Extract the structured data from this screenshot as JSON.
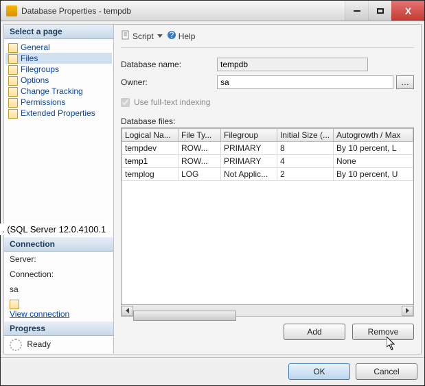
{
  "window": {
    "title": "Database Properties - tempdb"
  },
  "toolbar": {
    "script": "Script",
    "help": "Help"
  },
  "sidebar": {
    "select_page": "Select a page",
    "items": [
      {
        "label": "General"
      },
      {
        "label": "Files"
      },
      {
        "label": "Filegroups"
      },
      {
        "label": "Options"
      },
      {
        "label": "Change Tracking"
      },
      {
        "label": "Permissions"
      },
      {
        "label": "Extended Properties"
      }
    ],
    "connection_title": "Connection",
    "server_label": "Server:",
    "server_tooltip": ". (SQL Server 12.0.4100.1",
    "connection_label": "Connection:",
    "connection_value": "sa",
    "view_connection": "View connection ",
    "progress_title": "Progress",
    "progress_status": "Ready"
  },
  "form": {
    "db_name_label": "Database name:",
    "db_name_value": "tempdb",
    "owner_label": "Owner:",
    "owner_value": "sa",
    "fulltext_label": "Use full-text indexing",
    "fulltext_checked": true,
    "files_label": "Database files:"
  },
  "grid": {
    "headers": [
      "Logical Na...",
      "File Ty...",
      "Filegroup",
      "Initial Size (...",
      "Autogrowth / Max"
    ],
    "rows": [
      {
        "name": "tempdev",
        "type": "ROW...",
        "group": "PRIMARY",
        "size": "8",
        "auto": "By 10 percent, L"
      },
      {
        "name": "temp1",
        "type": "ROW...",
        "group": "PRIMARY",
        "size": "4",
        "auto": "None"
      },
      {
        "name": "templog",
        "type": "LOG",
        "group": "Not Applic...",
        "size": "2",
        "auto": "By 10 percent, U"
      }
    ]
  },
  "buttons": {
    "add": "Add",
    "remove": "Remove",
    "ok": "OK",
    "cancel": "Cancel"
  }
}
